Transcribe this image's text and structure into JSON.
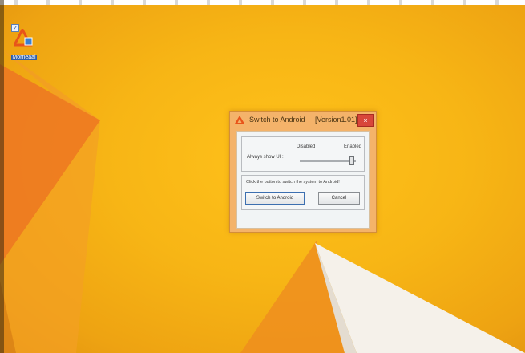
{
  "desktop": {
    "icon_label": "Morneaal",
    "colors": {
      "wallpaper": "#f7b515",
      "accent_orange": "#e86e1c",
      "white_shape": "#f5f1ea"
    }
  },
  "dialog": {
    "title": "Switch to Android",
    "version": "[Version1.01]",
    "close_glyph": "×",
    "labels": {
      "disabled": "Disabled",
      "enabled": "Enabled",
      "always_show": "Always show UI :",
      "instruction": "Click the button to switch the system to Android!"
    },
    "slider_value": "enabled",
    "buttons": {
      "switch": "Switch to Android",
      "cancel": "Cancel"
    },
    "colors": {
      "frame": "#f4b36a",
      "close": "#d8463a",
      "logo": "#e8541a"
    }
  }
}
